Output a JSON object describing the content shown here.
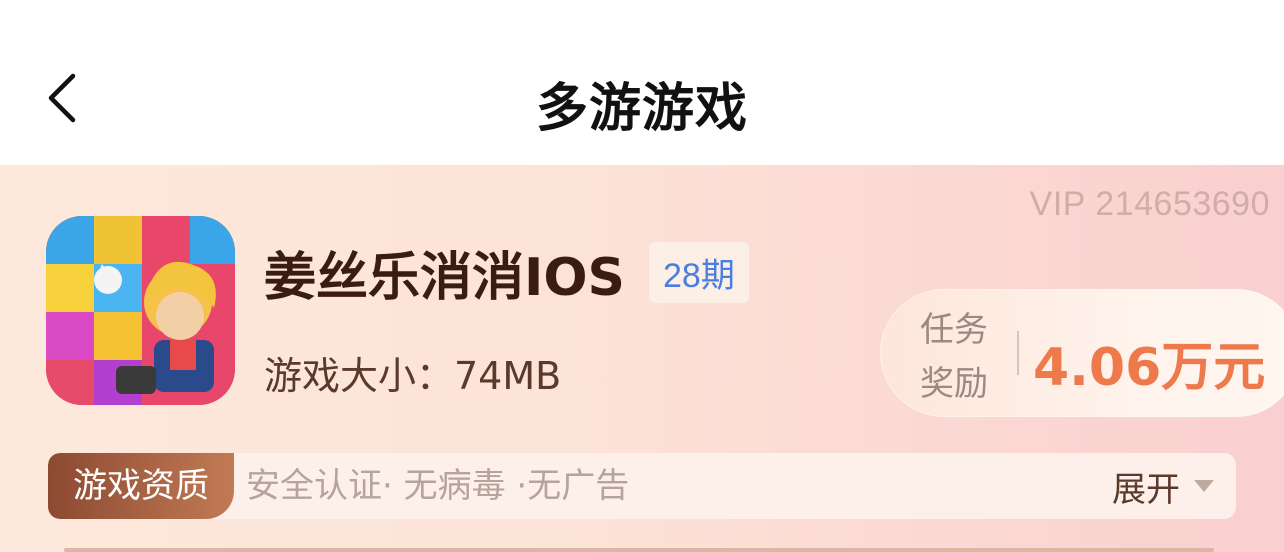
{
  "header": {
    "title": "多游游戏"
  },
  "card": {
    "vip_text": "VIP 214653690",
    "game": {
      "title": "姜丝乐消消IOS",
      "period_badge": "28期",
      "size_text": "游戏大小：74MB"
    },
    "reward": {
      "label_line1": "任务",
      "label_line2": "奖励",
      "amount": "4.06万元"
    },
    "qualification": {
      "tag": "游戏资质",
      "text": "安全认证· 无病毒 ·无广告",
      "expand_label": "展开"
    }
  },
  "colors": {
    "accent_orange": "#ee7a4c",
    "badge_blue": "#4a7ee0",
    "tag_brown": "#8d4a32"
  },
  "icons": [
    "back-arrow-icon",
    "game-app-icon",
    "dropdown-triangle-icon"
  ]
}
